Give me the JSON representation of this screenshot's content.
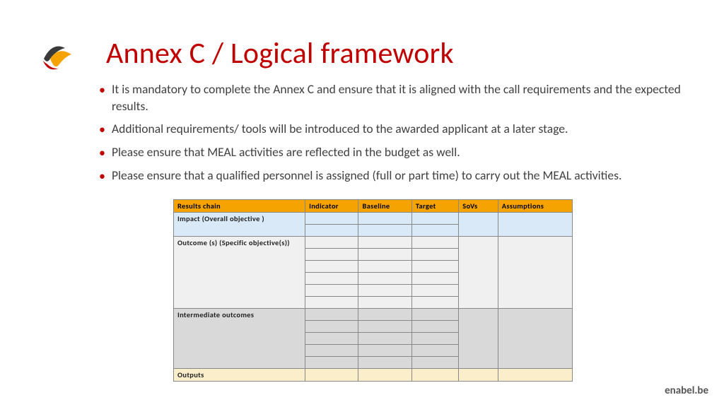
{
  "title": "Annex C / Logical framework",
  "bullets": [
    "It is mandatory to complete the Annex C and ensure that it is aligned with the call requirements and the expected results.",
    "Additional requirements/ tools will be introduced to the awarded applicant at a later stage.",
    "Please ensure that MEAL activities are reflected in the budget as well.",
    "Please ensure that a qualified personnel is assigned (full or part time) to carry out the MEAL activities."
  ],
  "table": {
    "headers": [
      "Results chain",
      "Indicator",
      "Baseline",
      "Target",
      "SoVs",
      "Assumptions"
    ],
    "sections": [
      {
        "label": "Impact (Overall  objective )",
        "rows": 2,
        "class": "row-impact"
      },
      {
        "label": "Outcome (s) (Specific objective(s))",
        "rows": 6,
        "class": "row-outcome"
      },
      {
        "label": "Intermediate outcomes",
        "rows": 5,
        "class": "row-inter"
      },
      {
        "label": "Outputs",
        "rows": 1,
        "class": "row-outputs"
      }
    ]
  },
  "footer": "enabel.be"
}
